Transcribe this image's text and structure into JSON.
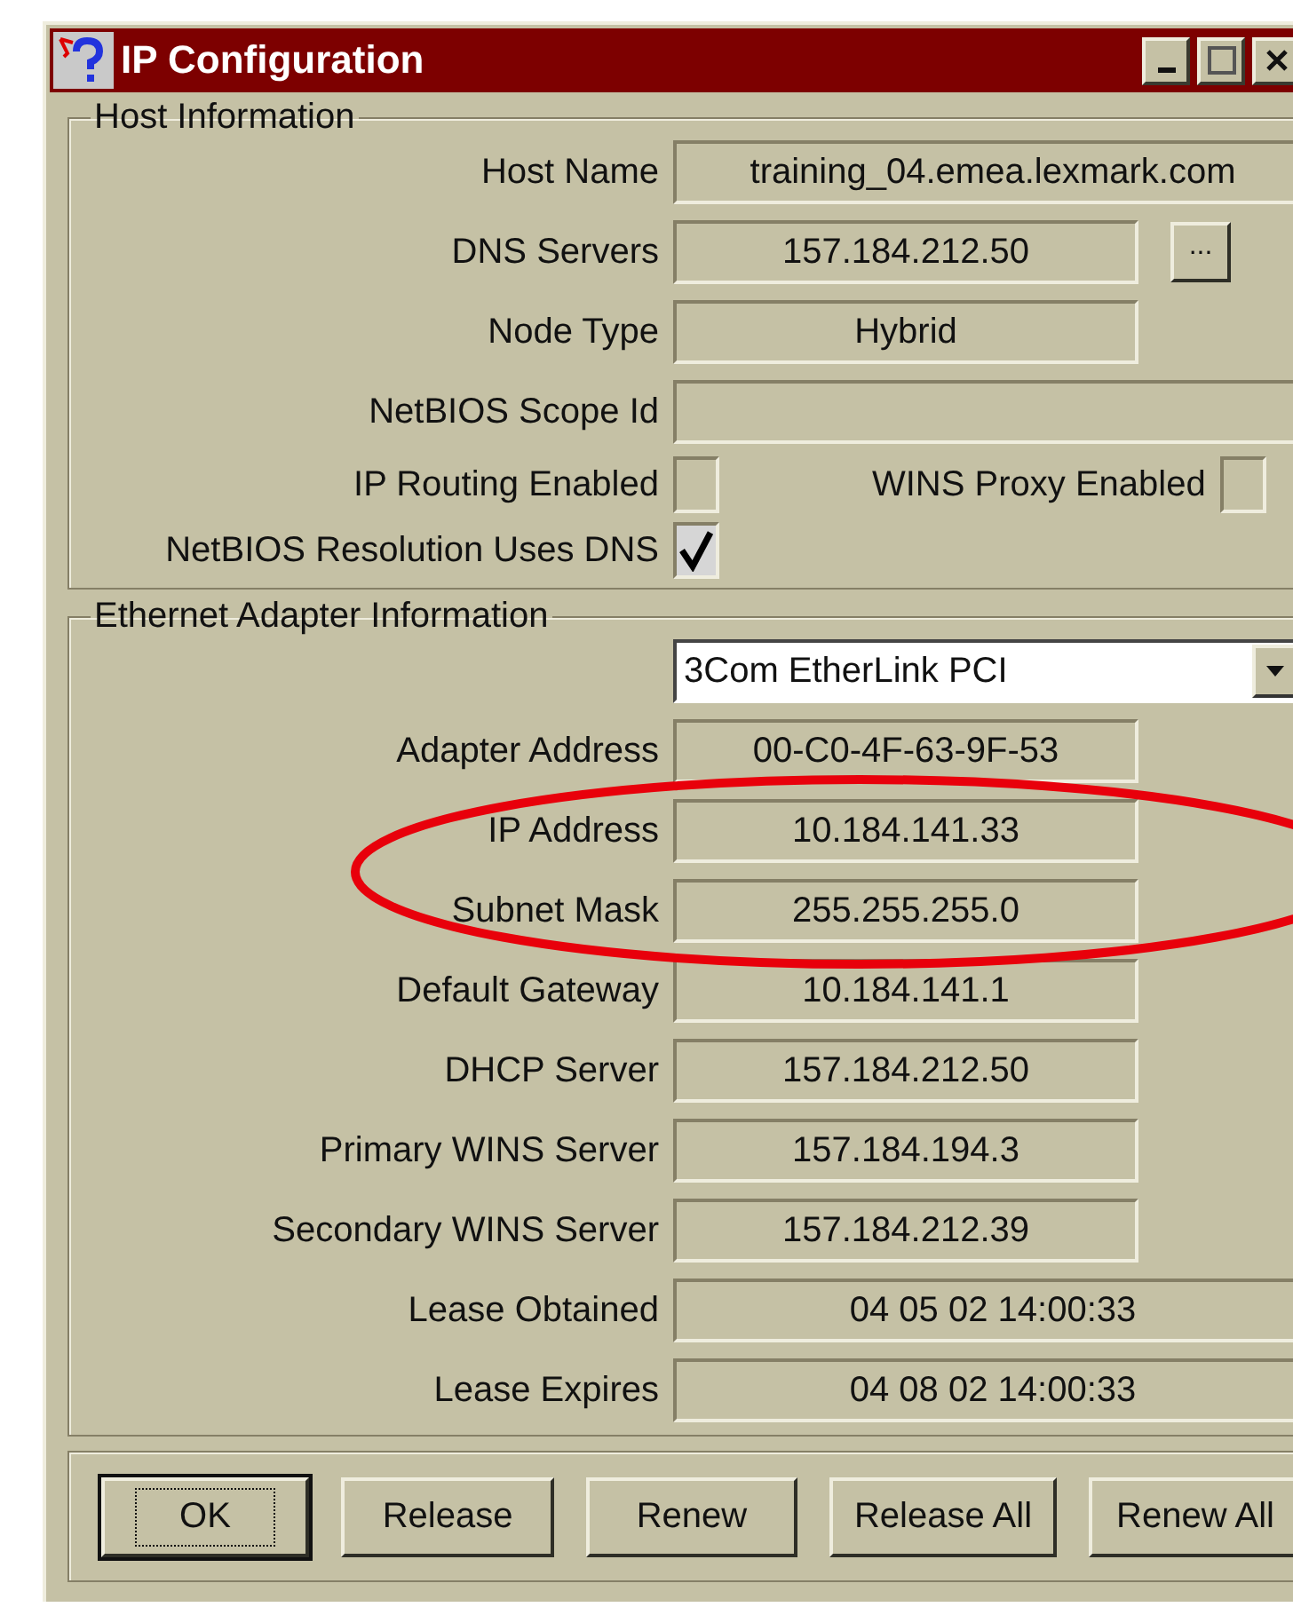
{
  "window": {
    "title": "IP Configuration",
    "controls": [
      {
        "kind": "minimize"
      },
      {
        "kind": "maximize"
      },
      {
        "kind": "close"
      }
    ]
  },
  "host_information": {
    "title": "Host Information",
    "rows": [
      {
        "kind": "wide-field",
        "label": "Host Name",
        "value": "training_04.emea.lexmark.com"
      },
      {
        "kind": "field-with-button",
        "label": "DNS Servers",
        "value": "157.184.212.50",
        "button": "..."
      },
      {
        "kind": "field",
        "label": "Node Type",
        "value": "Hybrid"
      },
      {
        "kind": "wide-field",
        "label": "NetBIOS Scope Id"
      },
      {
        "kind": "checkbox-pair",
        "label": "IP Routing Enabled",
        "checked": false,
        "second_label": "WINS Proxy Enabled",
        "second_checked": false
      },
      {
        "kind": "checkbox",
        "label": "NetBIOS Resolution Uses DNS",
        "checked": true
      }
    ]
  },
  "ethernet_adapter_information": {
    "title": "Ethernet  Adapter Information",
    "rows": [
      {
        "kind": "dropdown",
        "value": "3Com EtherLink PCI"
      },
      {
        "kind": "field",
        "label": "Adapter Address",
        "value": "00-C0-4F-63-9F-53"
      },
      {
        "kind": "field",
        "label": "IP Address",
        "value": "10.184.141.33"
      },
      {
        "kind": "field",
        "label": "Subnet Mask",
        "value": "255.255.255.0"
      },
      {
        "kind": "field",
        "label": "Default Gateway",
        "value": "10.184.141.1"
      },
      {
        "kind": "field",
        "label": "DHCP Server",
        "value": "157.184.212.50"
      },
      {
        "kind": "field",
        "label": "Primary WINS Server",
        "value": "157.184.194.3"
      },
      {
        "kind": "field",
        "label": "Secondary WINS Server",
        "value": "157.184.212.39"
      },
      {
        "kind": "wide-field",
        "label": "Lease Obtained",
        "value": "04 05 02 14:00:33"
      },
      {
        "kind": "wide-field",
        "label": "Lease Expires",
        "value": "04 08 02 14:00:33"
      }
    ]
  },
  "annotations": [
    {
      "kind": "ellipse"
    }
  ],
  "buttons": [
    {
      "label": "OK",
      "focused": true
    },
    {
      "label": "Release",
      "focused": false
    },
    {
      "label": "Renew",
      "focused": false
    },
    {
      "label": "Release All",
      "focused": false
    },
    {
      "label": "Renew All",
      "focused": false
    }
  ]
}
